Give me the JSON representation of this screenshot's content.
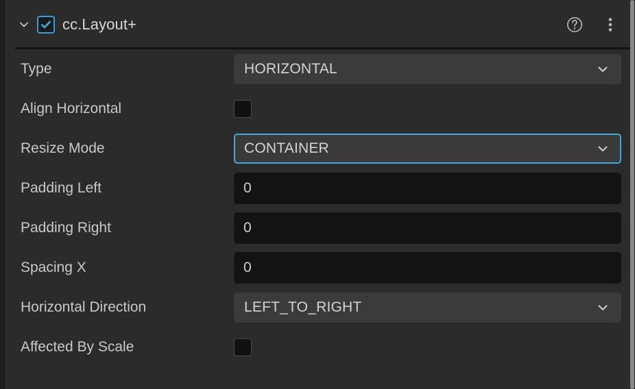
{
  "panel": {
    "header": {
      "twisty_icon": "chevron-down-icon",
      "enabled_checkbox_checked": true,
      "title": "cc.Layout+",
      "help_icon": "help-circle-icon",
      "menu_icon": "more-vertical-icon"
    },
    "accent_color": "#3fa9e0",
    "background_color": "#2b2b2b",
    "rows": [
      {
        "label": "Type",
        "control": "dropdown",
        "value": "HORIZONTAL",
        "focused": false
      },
      {
        "label": "Align Horizontal",
        "control": "checkbox",
        "checked": false
      },
      {
        "label": "Resize Mode",
        "control": "dropdown",
        "value": "CONTAINER",
        "focused": true
      },
      {
        "label": "Padding Left",
        "control": "number",
        "value": "0"
      },
      {
        "label": "Padding Right",
        "control": "number",
        "value": "0"
      },
      {
        "label": "Spacing X",
        "control": "number",
        "value": "0"
      },
      {
        "label": "Horizontal Direction",
        "control": "dropdown",
        "value": "LEFT_TO_RIGHT",
        "focused": false
      },
      {
        "label": "Affected By Scale",
        "control": "checkbox",
        "checked": false
      }
    ]
  }
}
